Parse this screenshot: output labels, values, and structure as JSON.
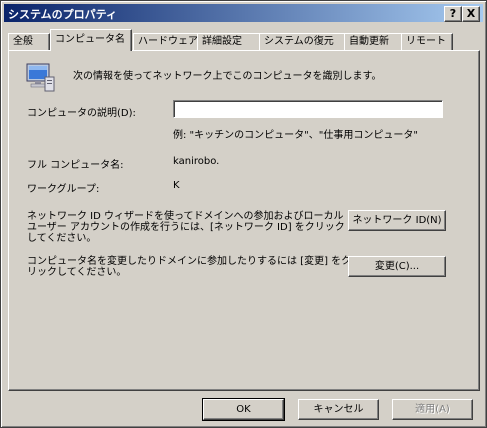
{
  "window": {
    "title": "システムのプロパティ",
    "help_button": "?",
    "close_button": "X"
  },
  "tabs": [
    {
      "label": "全般"
    },
    {
      "label": "コンピュータ名"
    },
    {
      "label": "ハードウェア"
    },
    {
      "label": "詳細設定"
    },
    {
      "label": "システムの復元"
    },
    {
      "label": "自動更新"
    },
    {
      "label": "リモート"
    }
  ],
  "active_tab": "コンピュータ名",
  "computer_name_tab": {
    "intro": "次の情報を使ってネットワーク上でこのコンピュータを識別します。",
    "description_label": "コンピュータの説明(D):",
    "description_value": "",
    "example": "例: \"キッチンのコンピュータ\"、\"仕事用コンピュータ\"",
    "full_name_label": "フル コンピュータ名:",
    "full_name_value": "kanirobo.",
    "workgroup_label": "ワークグループ:",
    "workgroup_value": "K",
    "network_id_text": [
      "ネットワーク ID ウィザードを使ってドメインへの参加およびローカル",
      "ユーザー アカウントの作成を行うには、[ネットワーク ID] をクリック",
      "してください。"
    ],
    "network_id_button": "ネットワーク ID(N)",
    "change_text": [
      "コンピュータ名を変更したりドメインに参加したりするには [変更] をク",
      "リックしてください。"
    ],
    "change_button": "変更(C)..."
  },
  "footer": {
    "ok_label": "OK",
    "cancel_label": "キャンセル",
    "apply_label": "適用(A)"
  }
}
